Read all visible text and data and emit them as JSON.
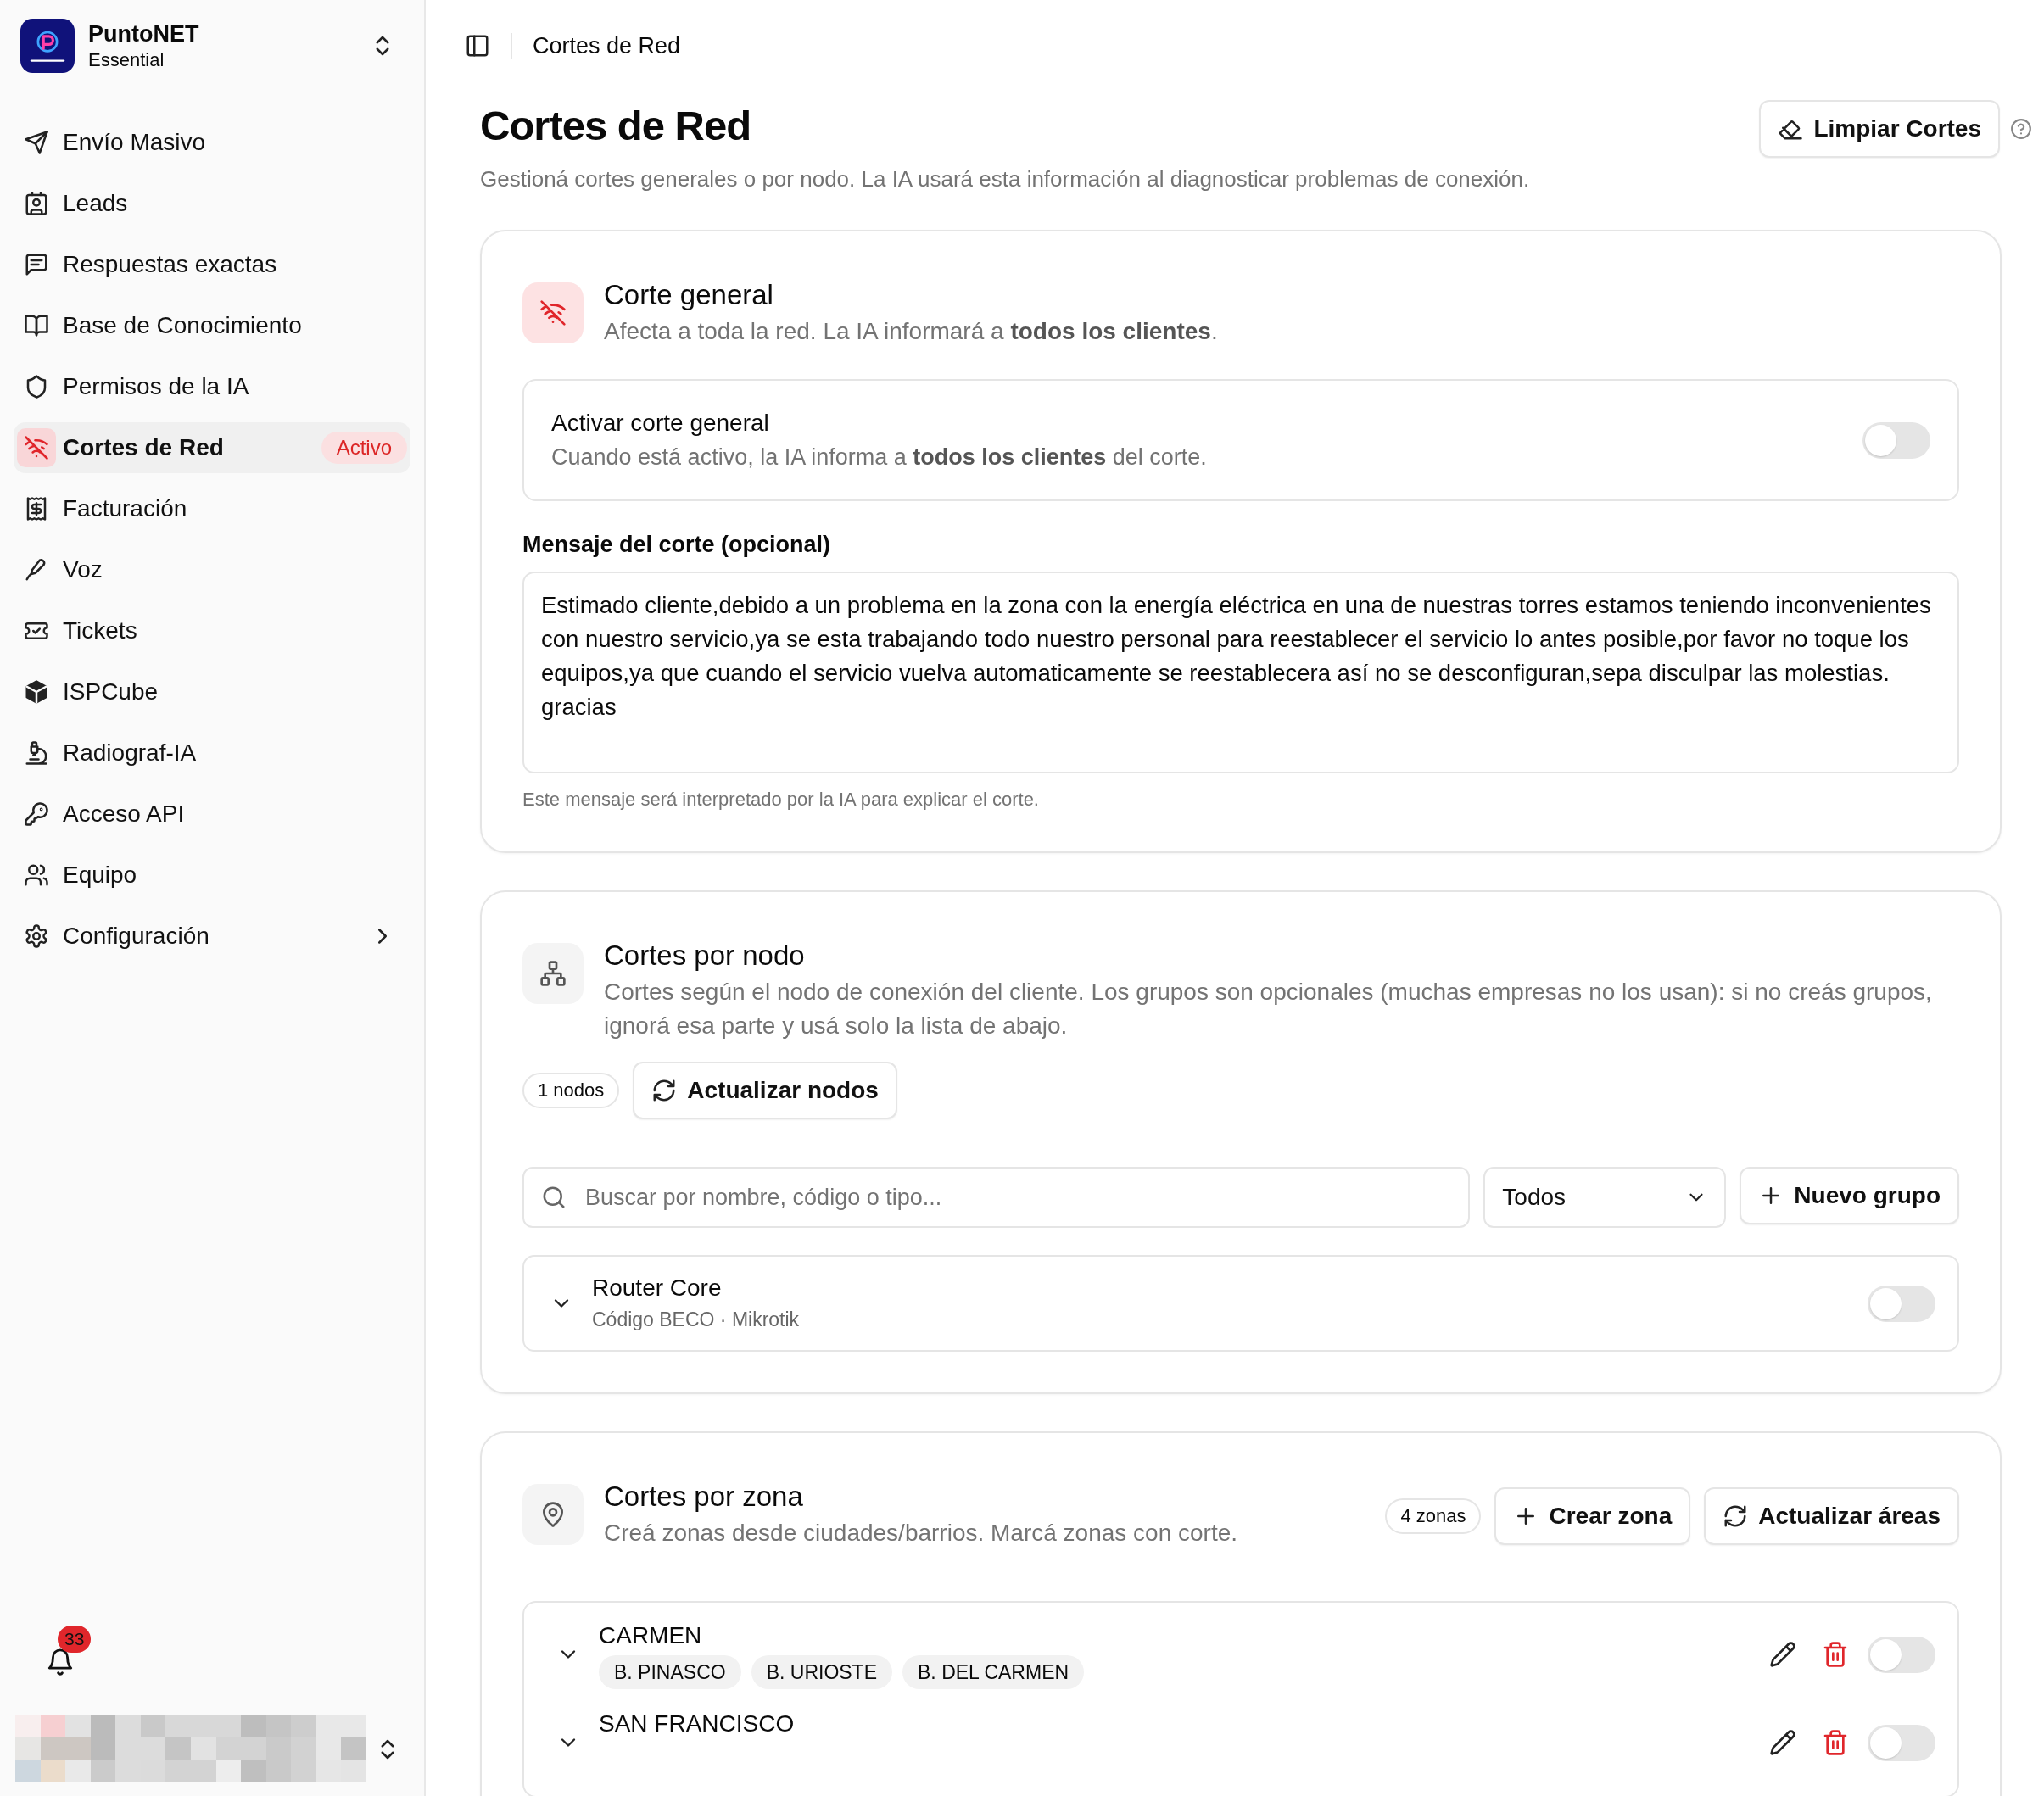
{
  "workspace": {
    "name": "PuntoNET",
    "plan": "Essential"
  },
  "sidebar": {
    "items": [
      {
        "label": "Envío Masivo",
        "selected": false,
        "submenu": false
      },
      {
        "label": "Leads",
        "selected": false,
        "submenu": false
      },
      {
        "label": "Respuestas exactas",
        "selected": false,
        "submenu": false
      },
      {
        "label": "Base de Conocimiento",
        "selected": false,
        "submenu": false
      },
      {
        "label": "Permisos de la IA",
        "selected": false,
        "submenu": false
      },
      {
        "label": "Cortes de Red",
        "selected": true,
        "submenu": false,
        "badge": "Activo"
      },
      {
        "label": "Facturación",
        "selected": false,
        "submenu": false
      },
      {
        "label": "Voz",
        "selected": false,
        "submenu": false
      },
      {
        "label": "Tickets",
        "selected": false,
        "submenu": false
      },
      {
        "label": "ISPCube",
        "selected": false,
        "submenu": false
      },
      {
        "label": "Radiograf-IA",
        "selected": false,
        "submenu": false
      },
      {
        "label": "Acceso API",
        "selected": false,
        "submenu": false
      },
      {
        "label": "Equipo",
        "selected": false,
        "submenu": false
      },
      {
        "label": "Configuración",
        "selected": false,
        "submenu": true
      }
    ]
  },
  "notifications": {
    "count": "33"
  },
  "topbar": {
    "breadcrumb": "Cortes de Red"
  },
  "page": {
    "title": "Cortes de Red",
    "subtitle": "Gestioná cortes generales o por nodo. La IA usará esta información al diagnosticar problemas de conexión.",
    "clear_button": "Limpiar Cortes"
  },
  "general": {
    "title": "Corte general",
    "description": "Afecta a toda la red. La IA informará a **todos los clientes**.",
    "toggle": {
      "label": "Activar corte general",
      "description": "Cuando está activo, la IA informa a **todos los clientes** del corte.",
      "on": false
    },
    "message_label": "Mensaje del corte (opcional)",
    "message_value": "Estimado cliente,debido a un problema en la zona con la energía eléctrica en una de nuestras torres estamos teniendo inconvenientes con nuestro servicio,ya se esta trabajando todo nuestro personal para reestablecer el servicio lo antes posible,por favor no toque los equipos,ya que cuando el servicio vuelva automaticamente se reestablecera así no se desconfiguran,sepa disculpar las molestias. gracias",
    "message_hint": "Este mensaje será interpretado por la IA para explicar el corte."
  },
  "nodes": {
    "title": "Cortes por nodo",
    "description": "Cortes según el nodo de conexión del cliente. Los grupos son opcionales (muchas empresas no los usan): si no creás grupos, ignorá esa parte y usá solo la lista de abajo.",
    "count": "1 nodos",
    "refresh_button": "Actualizar nodos",
    "search_placeholder": "Buscar por nombre, código o tipo...",
    "filter": "Todos",
    "new_group_button": "Nuevo grupo",
    "items": [
      {
        "name": "Router Core",
        "detail": "Código BECO · Mikrotik",
        "on": false,
        "expanded": false
      }
    ]
  },
  "zones": {
    "title": "Cortes por zona",
    "description": "Creá zonas desde ciudades/barrios. Marcá zonas con corte.",
    "count": "4 zonas",
    "create_button": "Crear zona",
    "refresh_button": "Actualizar áreas",
    "items": [
      {
        "name": "CARMEN",
        "tags": [
          "B. PINASCO",
          "B. URIOSTE",
          "B. DEL CARMEN"
        ],
        "on": false,
        "expanded": false
      },
      {
        "name": "SAN FRANCISCO",
        "on": false,
        "expanded": false
      }
    ]
  }
}
